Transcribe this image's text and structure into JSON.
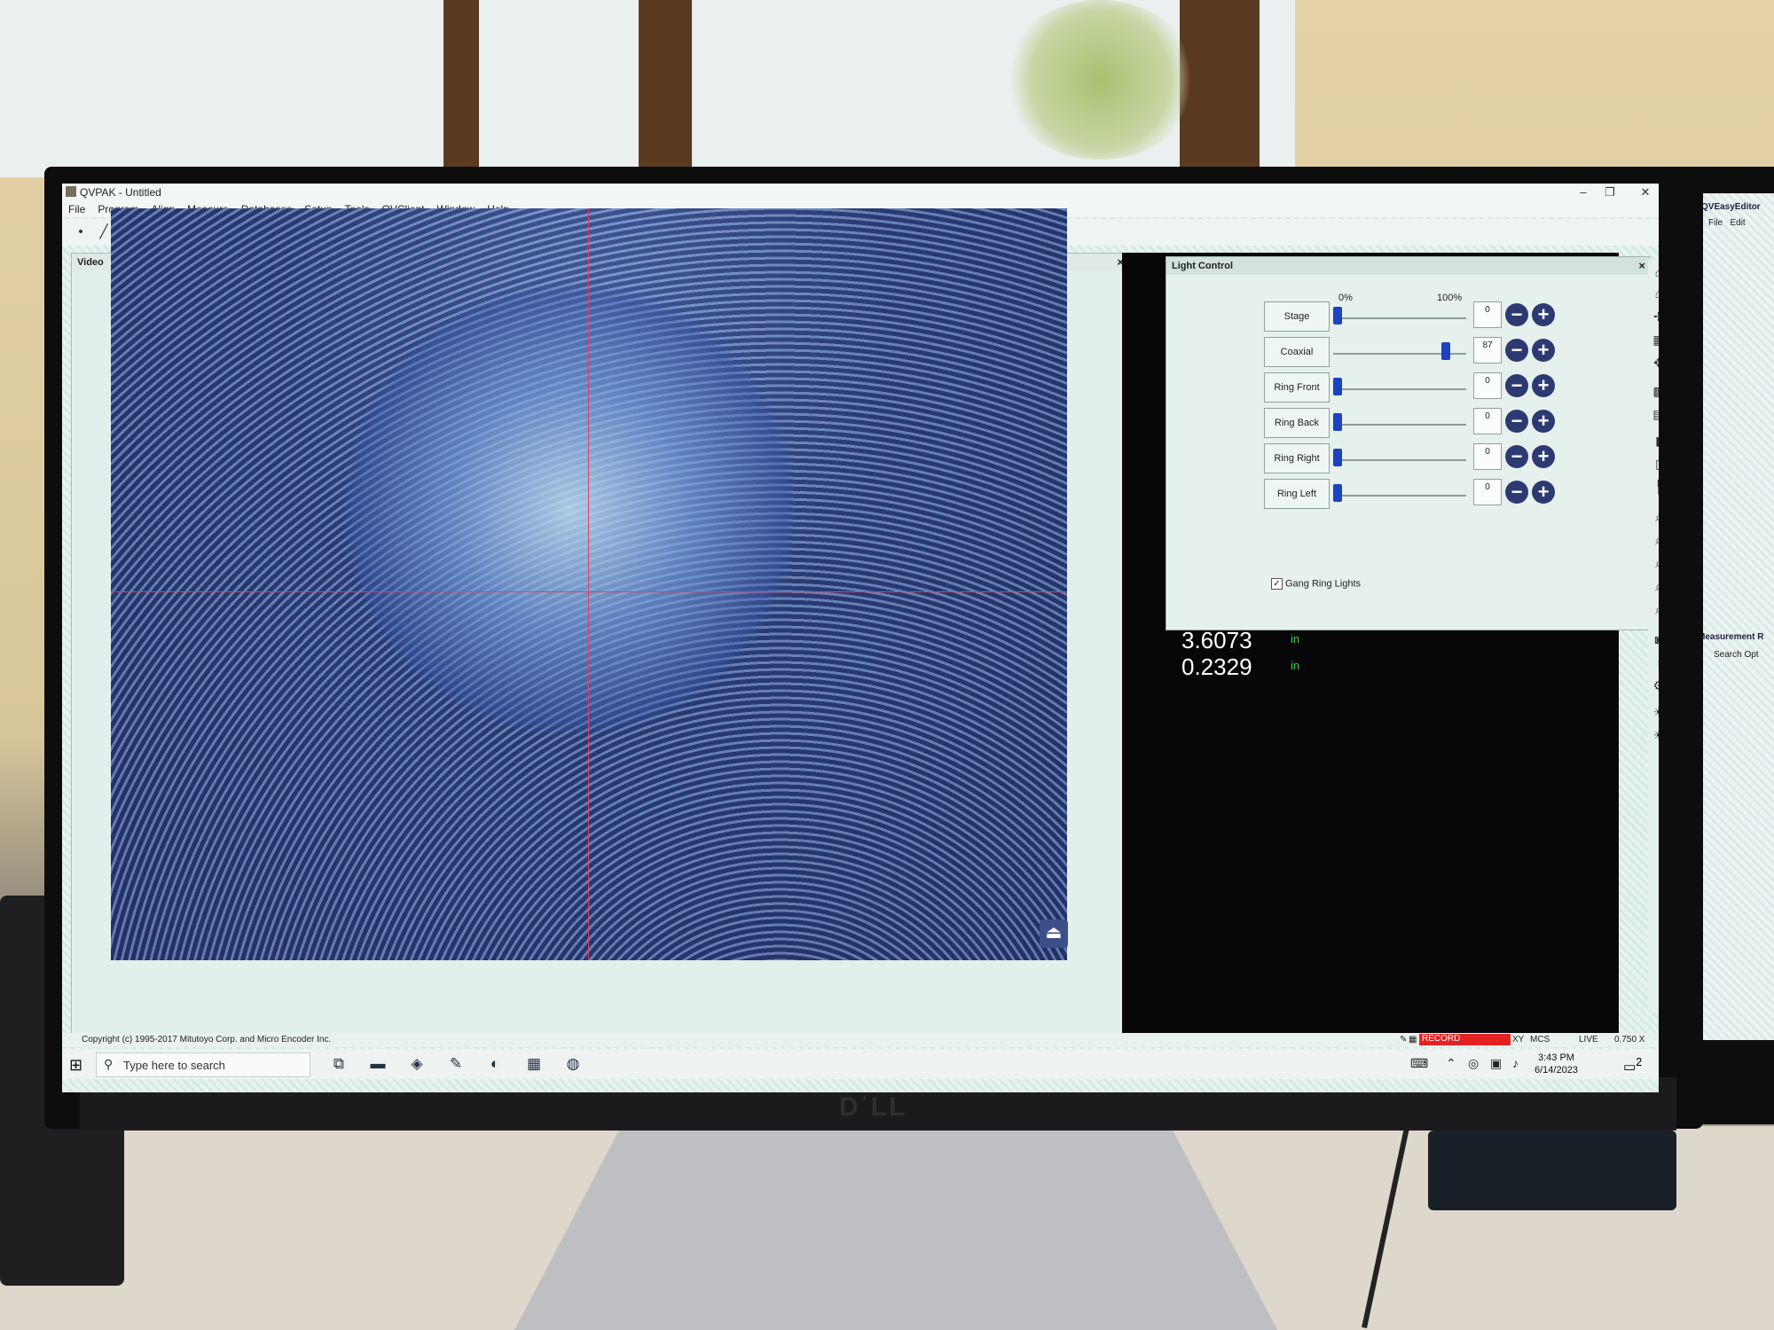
{
  "app": {
    "title": "QVPAK - Untitled",
    "window_controls": {
      "minimize": "–",
      "restore": "❐",
      "close": "✕"
    }
  },
  "menu": [
    "File",
    "Program",
    "Align",
    "Measure",
    "Databases",
    "Setup",
    "Tools",
    "QVClient",
    "Window",
    "Help"
  ],
  "toolbar_icons": [
    "point-icon",
    "line-icon",
    "circle-icon",
    "ellipse-icon",
    "plane-icon",
    "sphere-icon",
    "cylinder-icon",
    "cylinder-icon",
    "cone-icon",
    "point-cloud-icon",
    "angle-icon",
    "distance-icon",
    "intersect-icon",
    "stack-icon",
    "torus-icon",
    "edit-icon",
    "width-icon",
    "angle-lines-icon",
    "chart-icon",
    "layers-icon",
    "branch-icon",
    "crosshair-icon",
    "axis-align-icon",
    "axis-align-icon",
    "axis-align-icon",
    "report-icon",
    "report-icon",
    "coordinate-icon"
  ],
  "video": {
    "title": "Video",
    "close": "×",
    "scroll_glyph": "⏏"
  },
  "light_control": {
    "title": "Light Control",
    "close": "×",
    "scale_min": "0%",
    "scale_max": "100%",
    "lights": [
      {
        "label": "Stage",
        "value": "0",
        "level": 0
      },
      {
        "label": "Coaxial",
        "value": "87",
        "level": 87
      },
      {
        "label": "Ring Front",
        "value": "0",
        "level": 0
      },
      {
        "label": "Ring Back",
        "value": "0",
        "level": 0
      },
      {
        "label": "Ring Right",
        "value": "0",
        "level": 0
      },
      {
        "label": "Ring Left",
        "value": "0",
        "level": 0
      }
    ],
    "gang_ring_lights": {
      "label": "Gang Ring Lights",
      "checked": true
    }
  },
  "readouts": [
    {
      "value": "3.6073",
      "unit": "in"
    },
    {
      "value": "0.2329",
      "unit": "in"
    }
  ],
  "status": {
    "copyright": "Copyright (c) 1995-2017 Mitutoyo Corp. and Micro Encoder Inc.",
    "record": "RECORD",
    "xy": "XY",
    "mcs": "MCS",
    "live": "LIVE",
    "zoom": "0.750 X"
  },
  "taskbar": {
    "search_placeholder": "Type here to search",
    "time": "3:43 PM",
    "date": "6/14/2023",
    "notification_count": "2"
  },
  "side_window": {
    "title": "QVEasyEditor",
    "menu": [
      "File",
      "Edit"
    ],
    "panel_title": "Measurement R",
    "search_label": "Search Opt"
  },
  "colors": {
    "crosshair": "#d7426a",
    "slider_thumb": "#1c43c0",
    "record_bg": "#e32222",
    "readout_unit": "#37d34a"
  }
}
